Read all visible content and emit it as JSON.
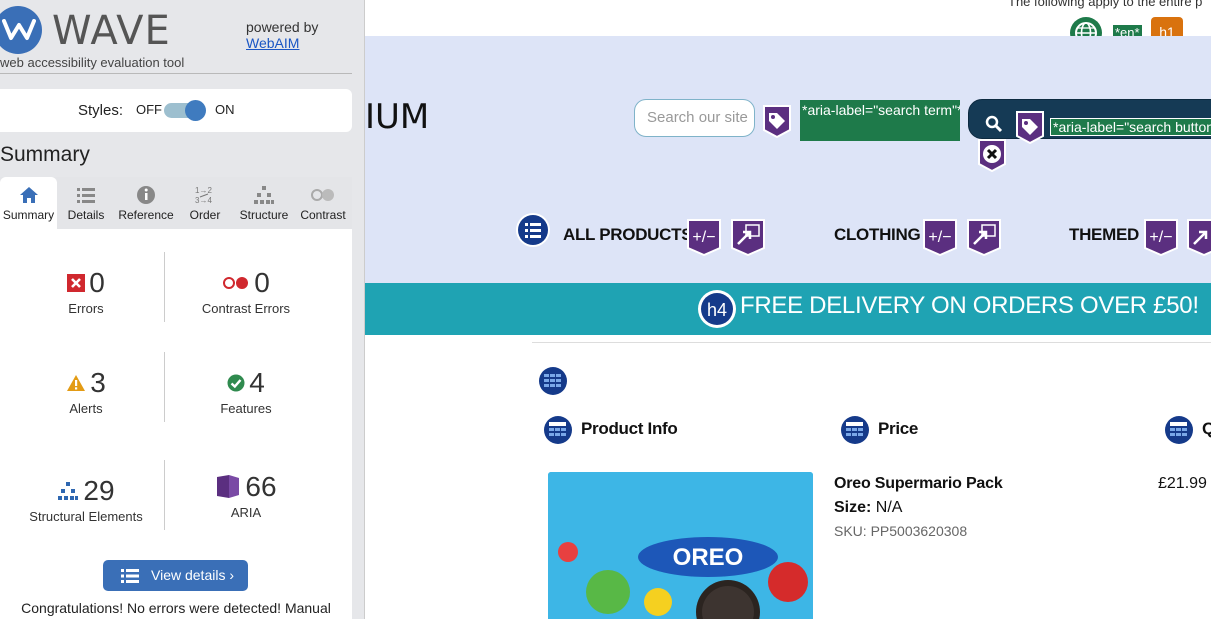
{
  "wave": {
    "title": "WAVE",
    "subtitle": "web accessibility evaluation tool",
    "powered_by": "powered by",
    "powered_link": "WebAIM",
    "styles": {
      "label": "Styles:",
      "off": "OFF",
      "on": "ON",
      "state": "on"
    },
    "summary_title": "Summary",
    "tabs": [
      {
        "label": "Summary",
        "icon": "home-icon",
        "active": true
      },
      {
        "label": "Details",
        "icon": "list-icon",
        "active": false
      },
      {
        "label": "Reference",
        "icon": "info-icon",
        "active": false
      },
      {
        "label": "Order",
        "icon": "order-icon",
        "active": false
      },
      {
        "label": "Structure",
        "icon": "structure-icon",
        "active": false
      },
      {
        "label": "Contrast",
        "icon": "contrast-icon",
        "active": false
      }
    ],
    "stats": {
      "errors": {
        "count": "0",
        "label": "Errors"
      },
      "contrast": {
        "count": "0",
        "label": "Contrast Errors"
      },
      "alerts": {
        "count": "3",
        "label": "Alerts"
      },
      "features": {
        "count": "4",
        "label": "Features"
      },
      "structural": {
        "count": "29",
        "label": "Structural Elements"
      },
      "aria": {
        "count": "66",
        "label": "ARIA"
      }
    },
    "view_details": "View details ›",
    "congrats": "Congratulations! No errors were detected! Manual"
  },
  "site": {
    "top_note": "The following apply to the entire p",
    "lang_badge": "*en*",
    "h1_badge": "h1",
    "logo_tail": "IUM",
    "search": {
      "placeholder": "Search our site"
    },
    "aria_search_term": "*aria-label=\"search term\"*",
    "aria_search_button": "*aria-label=\"search button\"*",
    "nav": [
      "ALL PRODUCTS",
      "CLOTHING",
      "THEMED"
    ],
    "h4_badge": "h4",
    "delivery": "FREE DELIVERY ON ORDERS OVER £50!",
    "table": {
      "headers": [
        "Product Info",
        "Price",
        "Q"
      ],
      "row": {
        "name": "Oreo Supermario Pack",
        "size_label": "Size:",
        "size_value": "N/A",
        "sku": "SKU: PP5003620308",
        "price": "£21.99",
        "image_text": "OREO"
      }
    }
  },
  "colors": {
    "wave_blue": "#3a6fb7",
    "teal": "#1fa3b3",
    "band": "#dde4f7",
    "aria_purple": "#5b2f80",
    "aria_green": "#1e7a4a"
  }
}
